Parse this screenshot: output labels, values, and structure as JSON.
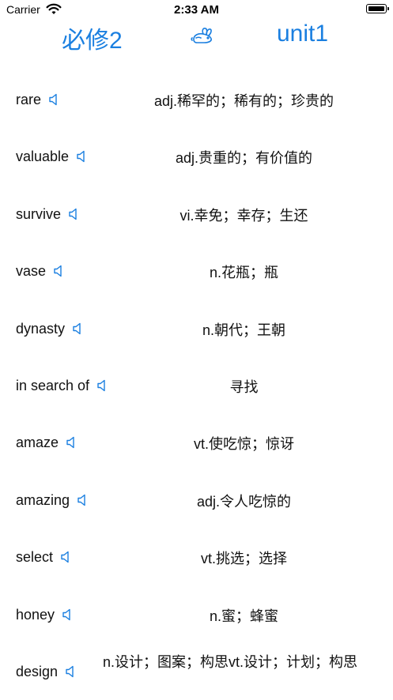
{
  "status_bar": {
    "carrier": "Carrier",
    "time": "2:33 AM"
  },
  "header": {
    "book": "必修2",
    "unit": "unit1",
    "accent_color": "#1a7fe0"
  },
  "words": [
    {
      "word": "rare",
      "meaning": "adj.稀罕的；稀有的；珍贵的"
    },
    {
      "word": "valuable",
      "meaning": "adj.贵重的；有价值的"
    },
    {
      "word": "survive",
      "meaning": "vi.幸免；幸存；生还"
    },
    {
      "word": "vase",
      "meaning": "n.花瓶；瓶"
    },
    {
      "word": "dynasty",
      "meaning": "n.朝代；王朝"
    },
    {
      "word": "in search of",
      "meaning": "寻找"
    },
    {
      "word": "amaze",
      "meaning": "vt.使吃惊；惊讶"
    },
    {
      "word": "amazing",
      "meaning": "adj.令人吃惊的"
    },
    {
      "word": "select",
      "meaning": "vt.挑选；选择"
    },
    {
      "word": "honey",
      "meaning": "n.蜜；蜂蜜"
    },
    {
      "word": "design",
      "meaning": "n.设计；图案；构思vt.设计；计划；构思"
    }
  ]
}
